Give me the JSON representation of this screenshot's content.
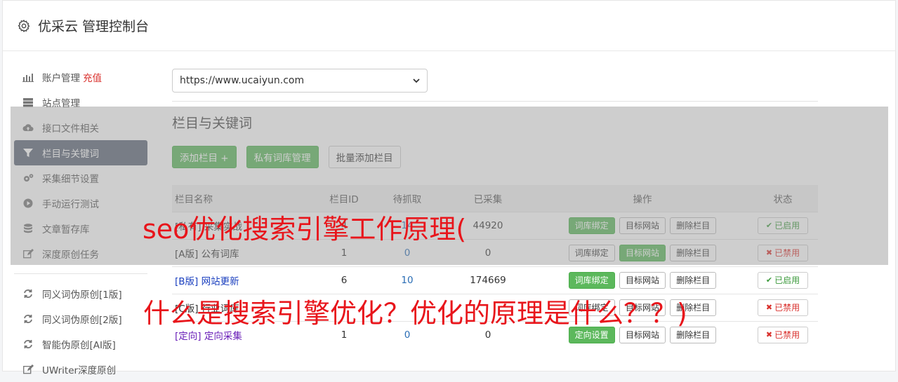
{
  "header": {
    "title": "优采云 管理控制台",
    "icon": "gear-icon"
  },
  "sidebar": {
    "items": [
      {
        "label": "账户管理",
        "extra": "充值",
        "icon": "bar-chart-icon"
      },
      {
        "label": "站点管理",
        "icon": "server-icon"
      },
      {
        "label": "接口文件相关",
        "icon": "cloud-upload-icon"
      },
      {
        "label": "栏目与关键词",
        "icon": "filter-icon",
        "active": true
      },
      {
        "label": "采集细节设置",
        "icon": "cogs-icon"
      },
      {
        "label": "手动运行测试",
        "icon": "play-circle-icon"
      },
      {
        "label": "文章暂存库",
        "icon": "database-icon"
      },
      {
        "label": "深度原创任务",
        "icon": "edit-icon"
      },
      {
        "label": "同义词伪原创[1版]",
        "icon": "refresh-icon"
      },
      {
        "label": "同义词伪原创[2版]",
        "icon": "refresh-icon"
      },
      {
        "label": "智能伪原创[AI版]",
        "icon": "refresh-icon"
      },
      {
        "label": "UWriter深度原创",
        "icon": "edit-icon"
      }
    ]
  },
  "main": {
    "site_select": "https://www.ucaiyun.com",
    "section_title": "栏目与关键词",
    "toolbar": {
      "add_column": "添加栏目 +",
      "private_lib": "私有词库管理",
      "batch_add": "批量添加栏目"
    },
    "table": {
      "headers": {
        "name": "栏目名称",
        "id": "栏目ID",
        "waiting": "待抓取",
        "collected": "已采集",
        "ops": "操作",
        "state": "状态"
      },
      "rows": [
        {
          "tag": "[私有]",
          "name": "采集实战",
          "id": "4",
          "waiting": "14",
          "collected": "44920",
          "op1": "词库绑定",
          "op2": "目标网站",
          "op3": "删除栏目",
          "state": "已启用"
        },
        {
          "tag": "[A版]",
          "name": "公有词库",
          "id": "1",
          "waiting": "0",
          "collected": "0",
          "op1": "词库绑定",
          "op2": "目标网站",
          "op3": "删除栏目",
          "state": "已禁用"
        },
        {
          "tag": "[B版]",
          "name": "网站更新",
          "id": "6",
          "waiting": "10",
          "collected": "174669",
          "op1": "词库绑定",
          "op2": "目标网站",
          "op3": "删除栏目",
          "state": "已启用"
        },
        {
          "tag": "[C版]",
          "name": "行业词库",
          "id": "",
          "waiting": "",
          "collected": "",
          "op1": "词库绑定",
          "op2": "目标网站",
          "op3": "删除栏目",
          "state": "已禁用"
        },
        {
          "tag": "[定向]",
          "name": "定向采集",
          "id": "1",
          "waiting": "0",
          "collected": "0",
          "op1": "定向设置",
          "op2": "目标网站",
          "op3": "删除栏目",
          "state": "已禁用"
        }
      ]
    }
  },
  "watermark": {
    "line1": "seo优化搜索引擎工作原理(",
    "line2": "什么是搜索引擎优化？优化的原理是什么？？)"
  },
  "colors": {
    "green": "#5cb85c",
    "active_nav": "#5d6778",
    "watermark": "#e8151b",
    "disabled": "#d9302c"
  }
}
